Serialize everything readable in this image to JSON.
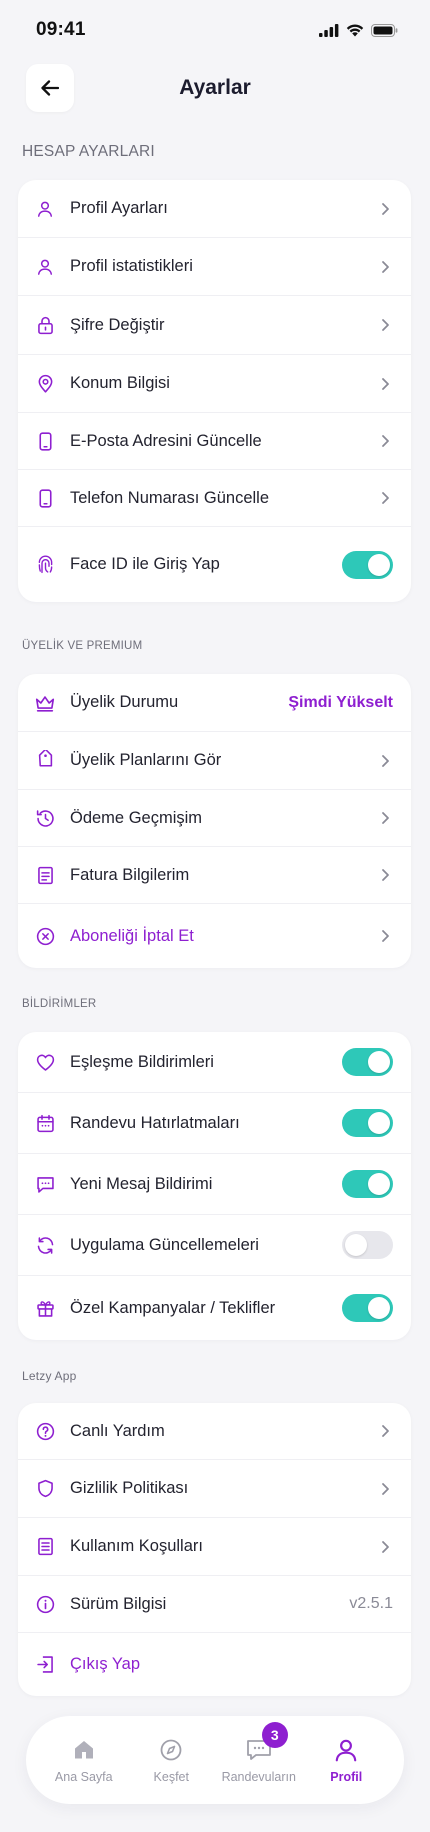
{
  "status_bar": {
    "time": "09:41"
  },
  "header": {
    "title": "Ayarlar"
  },
  "sections": {
    "account": {
      "title": "HESAP AYARLARI",
      "items": [
        {
          "label": "Profil  Ayarları",
          "icon": "user-icon"
        },
        {
          "label": "Profil istatistikleri",
          "icon": "user-icon"
        },
        {
          "label": "Şifre Değiştir",
          "icon": "lock-icon"
        },
        {
          "label": "Konum Bilgisi",
          "icon": "location-pin-icon"
        },
        {
          "label": "E-Posta Adresini Güncelle",
          "icon": "phone-icon"
        },
        {
          "label": "Telefon Numarası Güncelle",
          "icon": "phone-icon"
        },
        {
          "label": "Face ID ile Giriş Yap",
          "icon": "fingerprint-icon",
          "toggle": true
        }
      ]
    },
    "membership": {
      "title": "ÜYELİK VE PREMIUM",
      "items": [
        {
          "label": "Üyelik Durumu",
          "icon": "crown-icon",
          "cta": "Şimdi Yükselt"
        },
        {
          "label": "Üyelik Planlarını Gör",
          "icon": "tag-icon"
        },
        {
          "label": "Ödeme Geçmişim",
          "icon": "history-icon"
        },
        {
          "label": "Fatura Bilgilerim",
          "icon": "document-icon"
        },
        {
          "label": "Aboneliği İptal Et",
          "icon": "cancel-circle-icon"
        }
      ]
    },
    "notifications": {
      "title": "BİLDİRİMLER",
      "items": [
        {
          "label": "Eşleşme Bildirimleri",
          "icon": "heart-icon",
          "toggle": true
        },
        {
          "label": "Randevu Hatırlatmaları",
          "icon": "calendar-icon",
          "toggle": true
        },
        {
          "label": "Yeni Mesaj Bildirimi",
          "icon": "message-icon",
          "toggle": true
        },
        {
          "label": "Uygulama Güncellemeleri",
          "icon": "refresh-icon",
          "toggle": false
        },
        {
          "label": "Özel Kampanyalar / Teklifler",
          "icon": "gift-icon",
          "toggle": true
        }
      ]
    },
    "app": {
      "title": "Letzy App",
      "items": [
        {
          "label": "Canlı Yardım",
          "icon": "help-circle-icon"
        },
        {
          "label": "Gizlilik Politikası",
          "icon": "shield-icon"
        },
        {
          "label": "Kullanım Koşulları",
          "icon": "list-document-icon"
        },
        {
          "label": "Sürüm Bilgisi",
          "icon": "info-icon",
          "value": "v2.5.1"
        },
        {
          "label": "Çıkış Yap",
          "icon": "logout-icon"
        }
      ]
    }
  },
  "tabbar": {
    "tabs": [
      {
        "label": "Ana Sayfa",
        "icon": "home-icon"
      },
      {
        "label": "Keşfet",
        "icon": "compass-icon"
      },
      {
        "label": "Randevuların",
        "icon": "chat-icon",
        "badge": "3"
      },
      {
        "label": "Profil",
        "icon": "user-icon",
        "active": true
      }
    ]
  },
  "colors": {
    "accent": "#8e1fd0",
    "toggle_on": "#2ec8b8",
    "toggle_off": "#e7e7ec",
    "background": "#f5f5f8"
  }
}
